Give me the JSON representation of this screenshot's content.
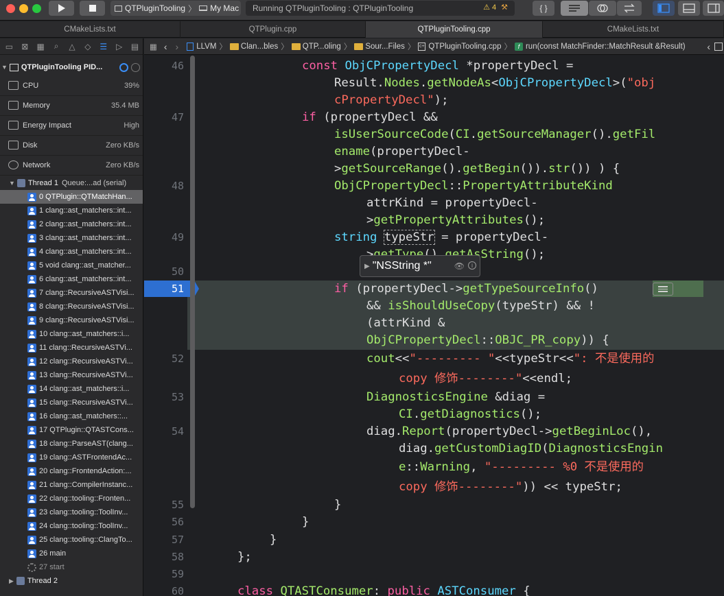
{
  "window": {
    "scheme_name": "QTPluginTooling",
    "scheme_chevron": "〉",
    "destination": "My Mac",
    "status_text": "Running QTPluginTooling : QTPluginTooling",
    "warning_count": "4"
  },
  "tabs": [
    {
      "label": "CMakeLists.txt"
    },
    {
      "label": "QTPlugin.cpp"
    },
    {
      "label": "QTPluginTooling.cpp"
    },
    {
      "label": "CMakeLists.txt"
    }
  ],
  "debug_nav": {
    "process_title": "QTPluginTooling PID...",
    "gauges": [
      {
        "label": "CPU",
        "value": "39%"
      },
      {
        "label": "Memory",
        "value": "35.4 MB"
      },
      {
        "label": "Energy Impact",
        "value": "High"
      },
      {
        "label": "Disk",
        "value": "Zero KB/s"
      },
      {
        "label": "Network",
        "value": "Zero KB/s"
      }
    ],
    "thread1_label": "Thread 1",
    "thread1_queue": "Queue:...ad (serial)",
    "frames": [
      "0 QTPlugin::QTMatchHan...",
      "1 clang::ast_matchers::int...",
      "2 clang::ast_matchers::int...",
      "3 clang::ast_matchers::int...",
      "4 clang::ast_matchers::int...",
      "5 void clang::ast_matcher...",
      "6 clang::ast_matchers::int...",
      "7 clang::RecursiveASTVisi...",
      "8 clang::RecursiveASTVisi...",
      "9 clang::RecursiveASTVisi...",
      "10 clang::ast_matchers::i...",
      "11 clang::RecursiveASTVi...",
      "12 clang::RecursiveASTVi...",
      "13 clang::RecursiveASTVi...",
      "14 clang::ast_matchers::i...",
      "15 clang::RecursiveASTVi...",
      "16 clang::ast_matchers::...",
      "17 QTPlugin::QTASTCons...",
      "18 clang::ParseAST(clang...",
      "19 clang::ASTFrontendAc...",
      "20 clang::FrontendAction:...",
      "21 clang::CompilerInstanc...",
      "22 clang::tooling::Fronten...",
      "23 clang::tooling::ToolInv...",
      "24 clang::tooling::ToolInv...",
      "25 clang::tooling::ClangTo...",
      "26 main",
      "27 start"
    ],
    "thread2_label": "Thread 2"
  },
  "jump_bar": {
    "items": [
      "LLVM",
      "Clan...bles",
      "QTP...oling",
      "Sour...Files",
      "QTPluginTooling.cpp",
      "run(const MatchFinder::MatchResult &Result)"
    ]
  },
  "editor": {
    "line_numbers": [
      {
        "n": "46"
      },
      {
        "n": "47"
      },
      {
        "n": "48"
      },
      {
        "n": "49"
      },
      {
        "n": "50"
      },
      {
        "n": "51"
      },
      {
        "n": "52"
      },
      {
        "n": "53"
      },
      {
        "n": "54"
      },
      {
        "n": "55"
      },
      {
        "n": "56"
      },
      {
        "n": "57"
      },
      {
        "n": "58"
      },
      {
        "n": "59"
      },
      {
        "n": "60"
      }
    ],
    "current_line": "51",
    "popover_value": "\"NSString *\""
  }
}
